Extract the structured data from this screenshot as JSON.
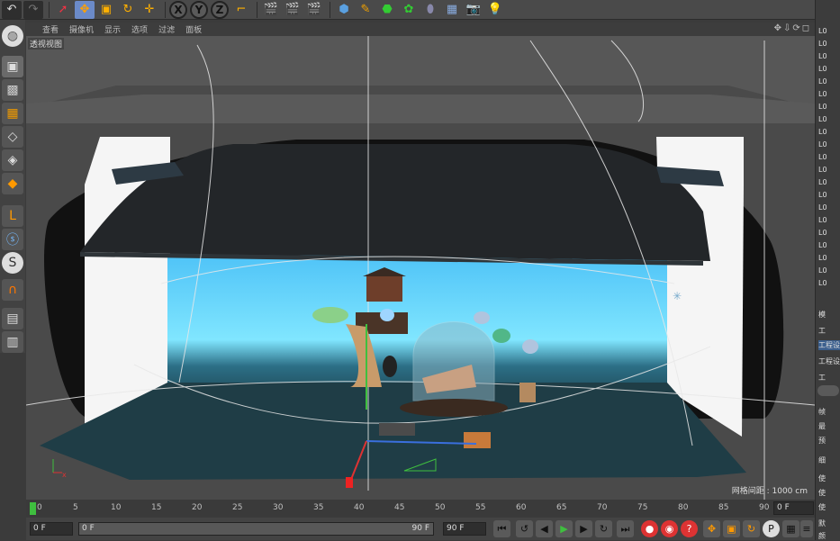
{
  "menu": [
    "查看",
    "摄像机",
    "显示",
    "选项",
    "过滤",
    "面板"
  ],
  "viewport": {
    "label": "透视视图",
    "grid_spacing": "网格间距 : 1000 cm"
  },
  "timeline": {
    "ticks": [
      "0",
      "5",
      "10",
      "15",
      "20",
      "25",
      "30",
      "35",
      "40",
      "45",
      "50",
      "55",
      "60",
      "65",
      "70",
      "75",
      "80",
      "85",
      "90"
    ]
  },
  "bottom": {
    "current_frame": "0 F",
    "start_field": "0 F",
    "range_start": "0 F",
    "range_end": "90 F",
    "end_field": "90 F",
    "right_frame": "0 F"
  },
  "right_panel": {
    "obj_label": "L0",
    "tab_attrib": "模",
    "tab_proj": "工",
    "proj_settings_1": "工程设",
    "proj_settings_2": "工程设",
    "item_1": "工",
    "item_2": "帧",
    "item_3": "最",
    "item_4": "预",
    "item_5": "细",
    "item_6": "使",
    "item_7": "使",
    "item_8": "使",
    "item_9": "默",
    "item_10": "颜"
  },
  "toolbar_axes": [
    "X",
    "Y",
    "Z"
  ],
  "colors": {
    "accent": "#f0a000",
    "sky": "#4fc3f7",
    "floor": "#1f3d46"
  }
}
